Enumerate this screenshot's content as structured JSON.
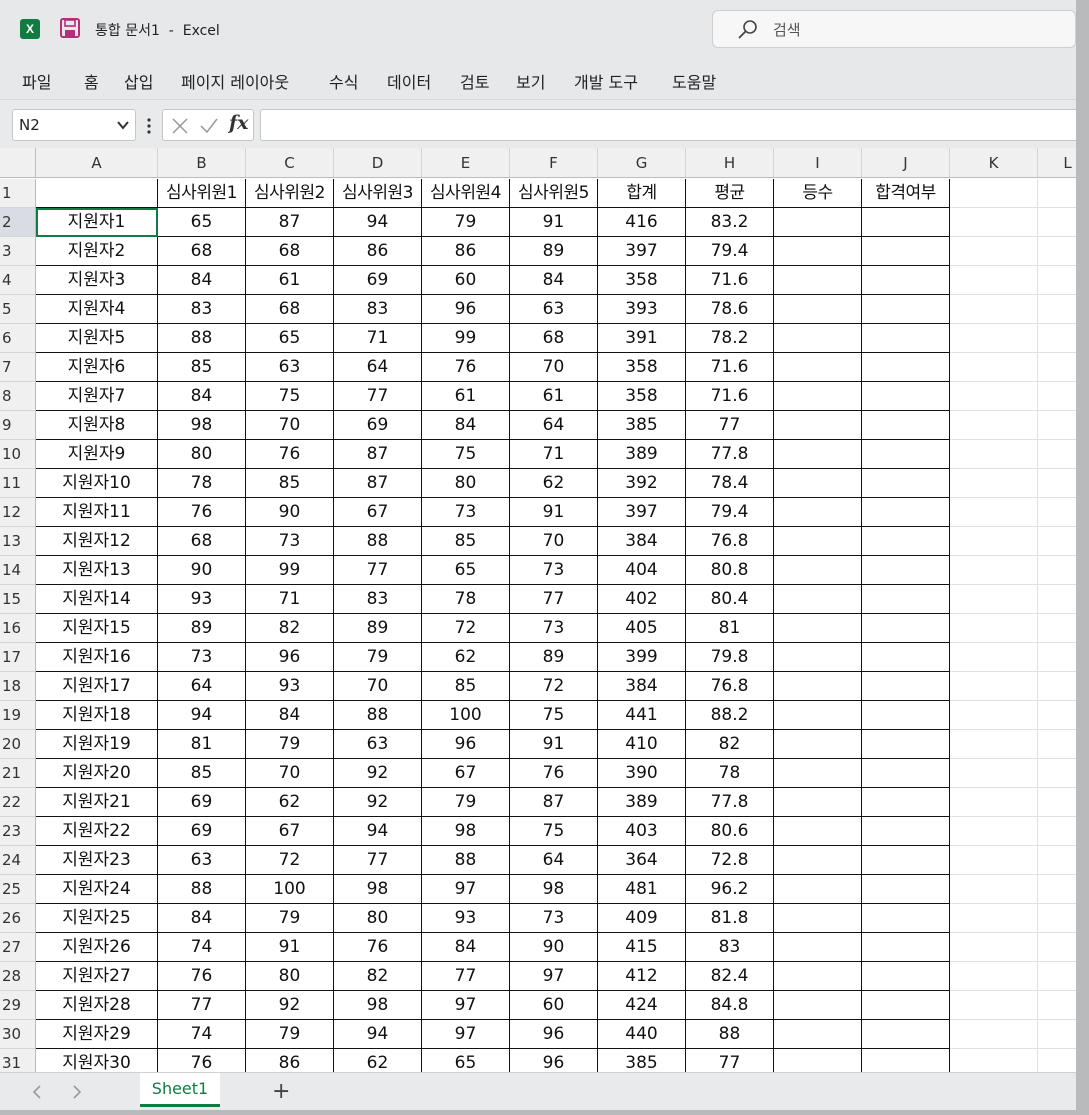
{
  "window": {
    "title": "통합 문서1  -  Excel",
    "search_placeholder": "검색"
  },
  "ribbon": {
    "tabs": [
      "파일",
      "홈",
      "삽입",
      "페이지 레이아웃",
      "수식",
      "데이터",
      "검토",
      "보기",
      "개발 도구",
      "도움말"
    ]
  },
  "formula_bar": {
    "name_box": "N2",
    "fx_label": "fx",
    "formula": ""
  },
  "sheet": {
    "columns": [
      "A",
      "B",
      "C",
      "D",
      "E",
      "F",
      "G",
      "H",
      "I",
      "J",
      "K",
      "L"
    ],
    "header_row": [
      "",
      "심사위원1",
      "심사위원2",
      "심사위원3",
      "심사위원4",
      "심사위원5",
      "합계",
      "평균",
      "등수",
      "합격여부"
    ],
    "rows": [
      [
        "지원자1",
        "65",
        "87",
        "94",
        "79",
        "91",
        "416",
        "83.2"
      ],
      [
        "지원자2",
        "68",
        "68",
        "86",
        "86",
        "89",
        "397",
        "79.4"
      ],
      [
        "지원자3",
        "84",
        "61",
        "69",
        "60",
        "84",
        "358",
        "71.6"
      ],
      [
        "지원자4",
        "83",
        "68",
        "83",
        "96",
        "63",
        "393",
        "78.6"
      ],
      [
        "지원자5",
        "88",
        "65",
        "71",
        "99",
        "68",
        "391",
        "78.2"
      ],
      [
        "지원자6",
        "85",
        "63",
        "64",
        "76",
        "70",
        "358",
        "71.6"
      ],
      [
        "지원자7",
        "84",
        "75",
        "77",
        "61",
        "61",
        "358",
        "71.6"
      ],
      [
        "지원자8",
        "98",
        "70",
        "69",
        "84",
        "64",
        "385",
        "77"
      ],
      [
        "지원자9",
        "80",
        "76",
        "87",
        "75",
        "71",
        "389",
        "77.8"
      ],
      [
        "지원자10",
        "78",
        "85",
        "87",
        "80",
        "62",
        "392",
        "78.4"
      ],
      [
        "지원자11",
        "76",
        "90",
        "67",
        "73",
        "91",
        "397",
        "79.4"
      ],
      [
        "지원자12",
        "68",
        "73",
        "88",
        "85",
        "70",
        "384",
        "76.8"
      ],
      [
        "지원자13",
        "90",
        "99",
        "77",
        "65",
        "73",
        "404",
        "80.8"
      ],
      [
        "지원자14",
        "93",
        "71",
        "83",
        "78",
        "77",
        "402",
        "80.4"
      ],
      [
        "지원자15",
        "89",
        "82",
        "89",
        "72",
        "73",
        "405",
        "81"
      ],
      [
        "지원자16",
        "73",
        "96",
        "79",
        "62",
        "89",
        "399",
        "79.8"
      ],
      [
        "지원자17",
        "64",
        "93",
        "70",
        "85",
        "72",
        "384",
        "76.8"
      ],
      [
        "지원자18",
        "94",
        "84",
        "88",
        "100",
        "75",
        "441",
        "88.2"
      ],
      [
        "지원자19",
        "81",
        "79",
        "63",
        "96",
        "91",
        "410",
        "82"
      ],
      [
        "지원자20",
        "85",
        "70",
        "92",
        "67",
        "76",
        "390",
        "78"
      ],
      [
        "지원자21",
        "69",
        "62",
        "92",
        "79",
        "87",
        "389",
        "77.8"
      ],
      [
        "지원자22",
        "69",
        "67",
        "94",
        "98",
        "75",
        "403",
        "80.6"
      ],
      [
        "지원자23",
        "63",
        "72",
        "77",
        "88",
        "64",
        "364",
        "72.8"
      ],
      [
        "지원자24",
        "88",
        "100",
        "98",
        "97",
        "98",
        "481",
        "96.2"
      ],
      [
        "지원자25",
        "84",
        "79",
        "80",
        "93",
        "73",
        "409",
        "81.8"
      ],
      [
        "지원자26",
        "74",
        "91",
        "76",
        "84",
        "90",
        "415",
        "83"
      ],
      [
        "지원자27",
        "76",
        "80",
        "82",
        "77",
        "97",
        "412",
        "82.4"
      ],
      [
        "지원자28",
        "77",
        "92",
        "98",
        "97",
        "60",
        "424",
        "84.8"
      ],
      [
        "지원자29",
        "74",
        "79",
        "94",
        "97",
        "96",
        "440",
        "88"
      ],
      [
        "지원자30",
        "76",
        "86",
        "62",
        "65",
        "96",
        "385",
        "77"
      ]
    ],
    "selected_cell": "N2"
  },
  "sheet_tabs": {
    "active": "Sheet1",
    "add_label": "+"
  },
  "colors": {
    "accent": "#107c41"
  }
}
